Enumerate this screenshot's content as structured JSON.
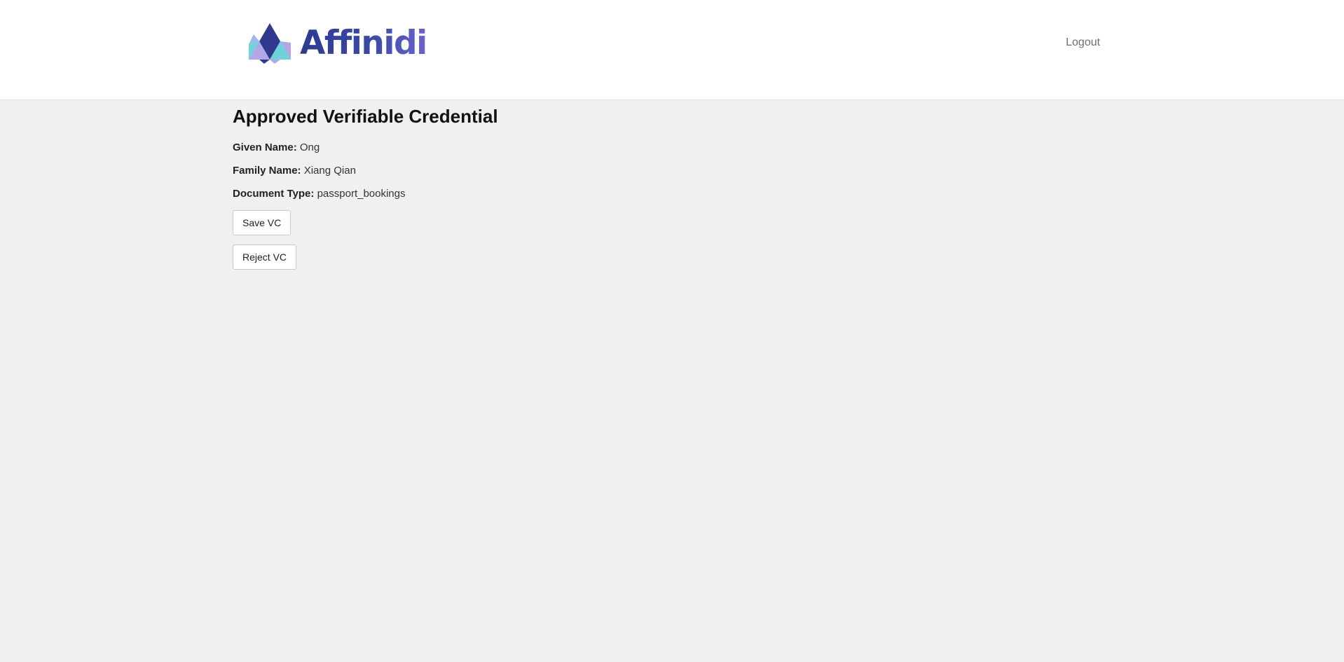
{
  "header": {
    "logo": {
      "text": "Affinidi",
      "icon": "affinidi-triangle-logo-icon",
      "colors": [
        "#2f3a8f",
        "#6ed3d9",
        "#b3a6e6",
        "#6b63c9"
      ]
    },
    "logout_label": "Logout"
  },
  "main": {
    "title": "Approved Verifiable Credential",
    "fields": [
      {
        "label": "Given Name:",
        "value": "Ong"
      },
      {
        "label": "Family Name:",
        "value": "Xiang Qian"
      },
      {
        "label": "Document Type:",
        "value": "passport_bookings"
      }
    ],
    "buttons": {
      "save_label": "Save VC",
      "reject_label": "Reject VC"
    }
  }
}
